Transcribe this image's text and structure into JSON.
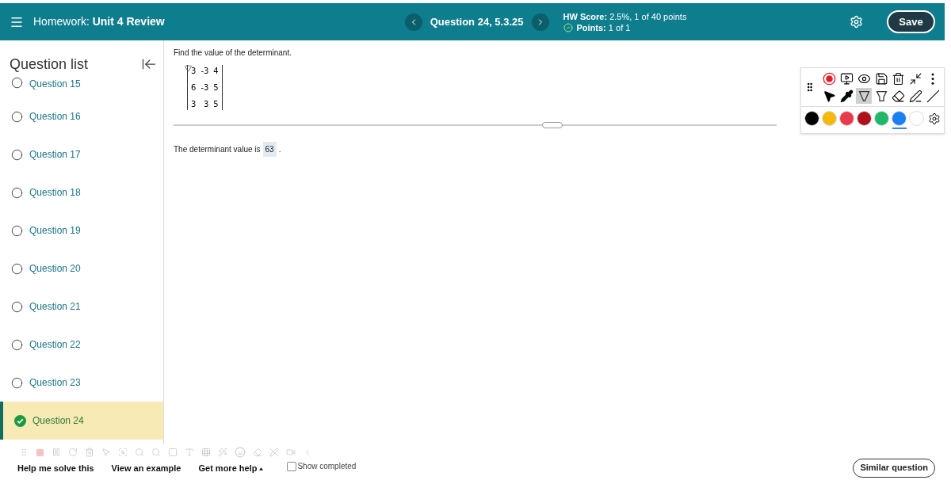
{
  "header": {
    "title_prefix": "Homework:",
    "title": "Unit 4 Review",
    "question_nav": "Question 24, 5.3.25",
    "hw_score_label": "HW Score:",
    "hw_score": "2.5%, 1 of 40 points",
    "points_label": "Points:",
    "points": "1 of 1",
    "points_correct": true,
    "save": "Save"
  },
  "sidebar": {
    "title": "Question list",
    "questions": [
      {
        "label": "Question 15",
        "completed": false,
        "selected": false
      },
      {
        "label": "Question 16",
        "completed": false,
        "selected": false
      },
      {
        "label": "Question 17",
        "completed": false,
        "selected": false
      },
      {
        "label": "Question 18",
        "completed": false,
        "selected": false
      },
      {
        "label": "Question 19",
        "completed": false,
        "selected": false
      },
      {
        "label": "Question 20",
        "completed": false,
        "selected": false
      },
      {
        "label": "Question 21",
        "completed": false,
        "selected": false
      },
      {
        "label": "Question 22",
        "completed": false,
        "selected": false
      },
      {
        "label": "Question 23",
        "completed": false,
        "selected": false
      },
      {
        "label": "Question 24",
        "completed": true,
        "selected": true
      }
    ]
  },
  "question": {
    "prompt": "Find the value of the determinant.",
    "matrix": [
      [
        "3",
        "-3",
        "4"
      ],
      [
        "6",
        "-3",
        "5"
      ],
      [
        "3",
        "3",
        "5"
      ]
    ],
    "answer_prefix": "The determinant value is",
    "answer": "63",
    "answer_suffix": "."
  },
  "annotation_toolbar": {
    "tools": [
      {
        "kind": "record",
        "selected": false
      },
      {
        "kind": "screen",
        "selected": false
      },
      {
        "kind": "view",
        "selected": false
      },
      {
        "kind": "save",
        "selected": false
      },
      {
        "kind": "delete",
        "selected": false
      },
      {
        "kind": "shrink",
        "selected": false
      },
      {
        "kind": "more",
        "selected": false
      },
      {
        "kind": "pointer",
        "selected": false
      },
      {
        "kind": "marker",
        "selected": false
      },
      {
        "kind": "pen",
        "selected": true
      },
      {
        "kind": "highlighter",
        "selected": false
      },
      {
        "kind": "eraser",
        "selected": false
      },
      {
        "kind": "text",
        "selected": false
      },
      {
        "kind": "line",
        "selected": false
      }
    ],
    "colors": [
      {
        "color": "#000000",
        "selected": false
      },
      {
        "color": "#f5b90a",
        "selected": false
      },
      {
        "color": "#e83a48",
        "selected": false
      },
      {
        "color": "#b0101c",
        "selected": false
      },
      {
        "color": "#1fb866",
        "selected": false
      },
      {
        "color": "#1a7ff0",
        "selected": true
      },
      {
        "color": "#ffffff",
        "selected": false
      }
    ]
  },
  "footer": {
    "help_buttons": [
      "Help me solve this",
      "View an example",
      "Get more help"
    ],
    "show_completed": {
      "label": "Show completed",
      "checked": false
    },
    "similar": "Similar question"
  }
}
